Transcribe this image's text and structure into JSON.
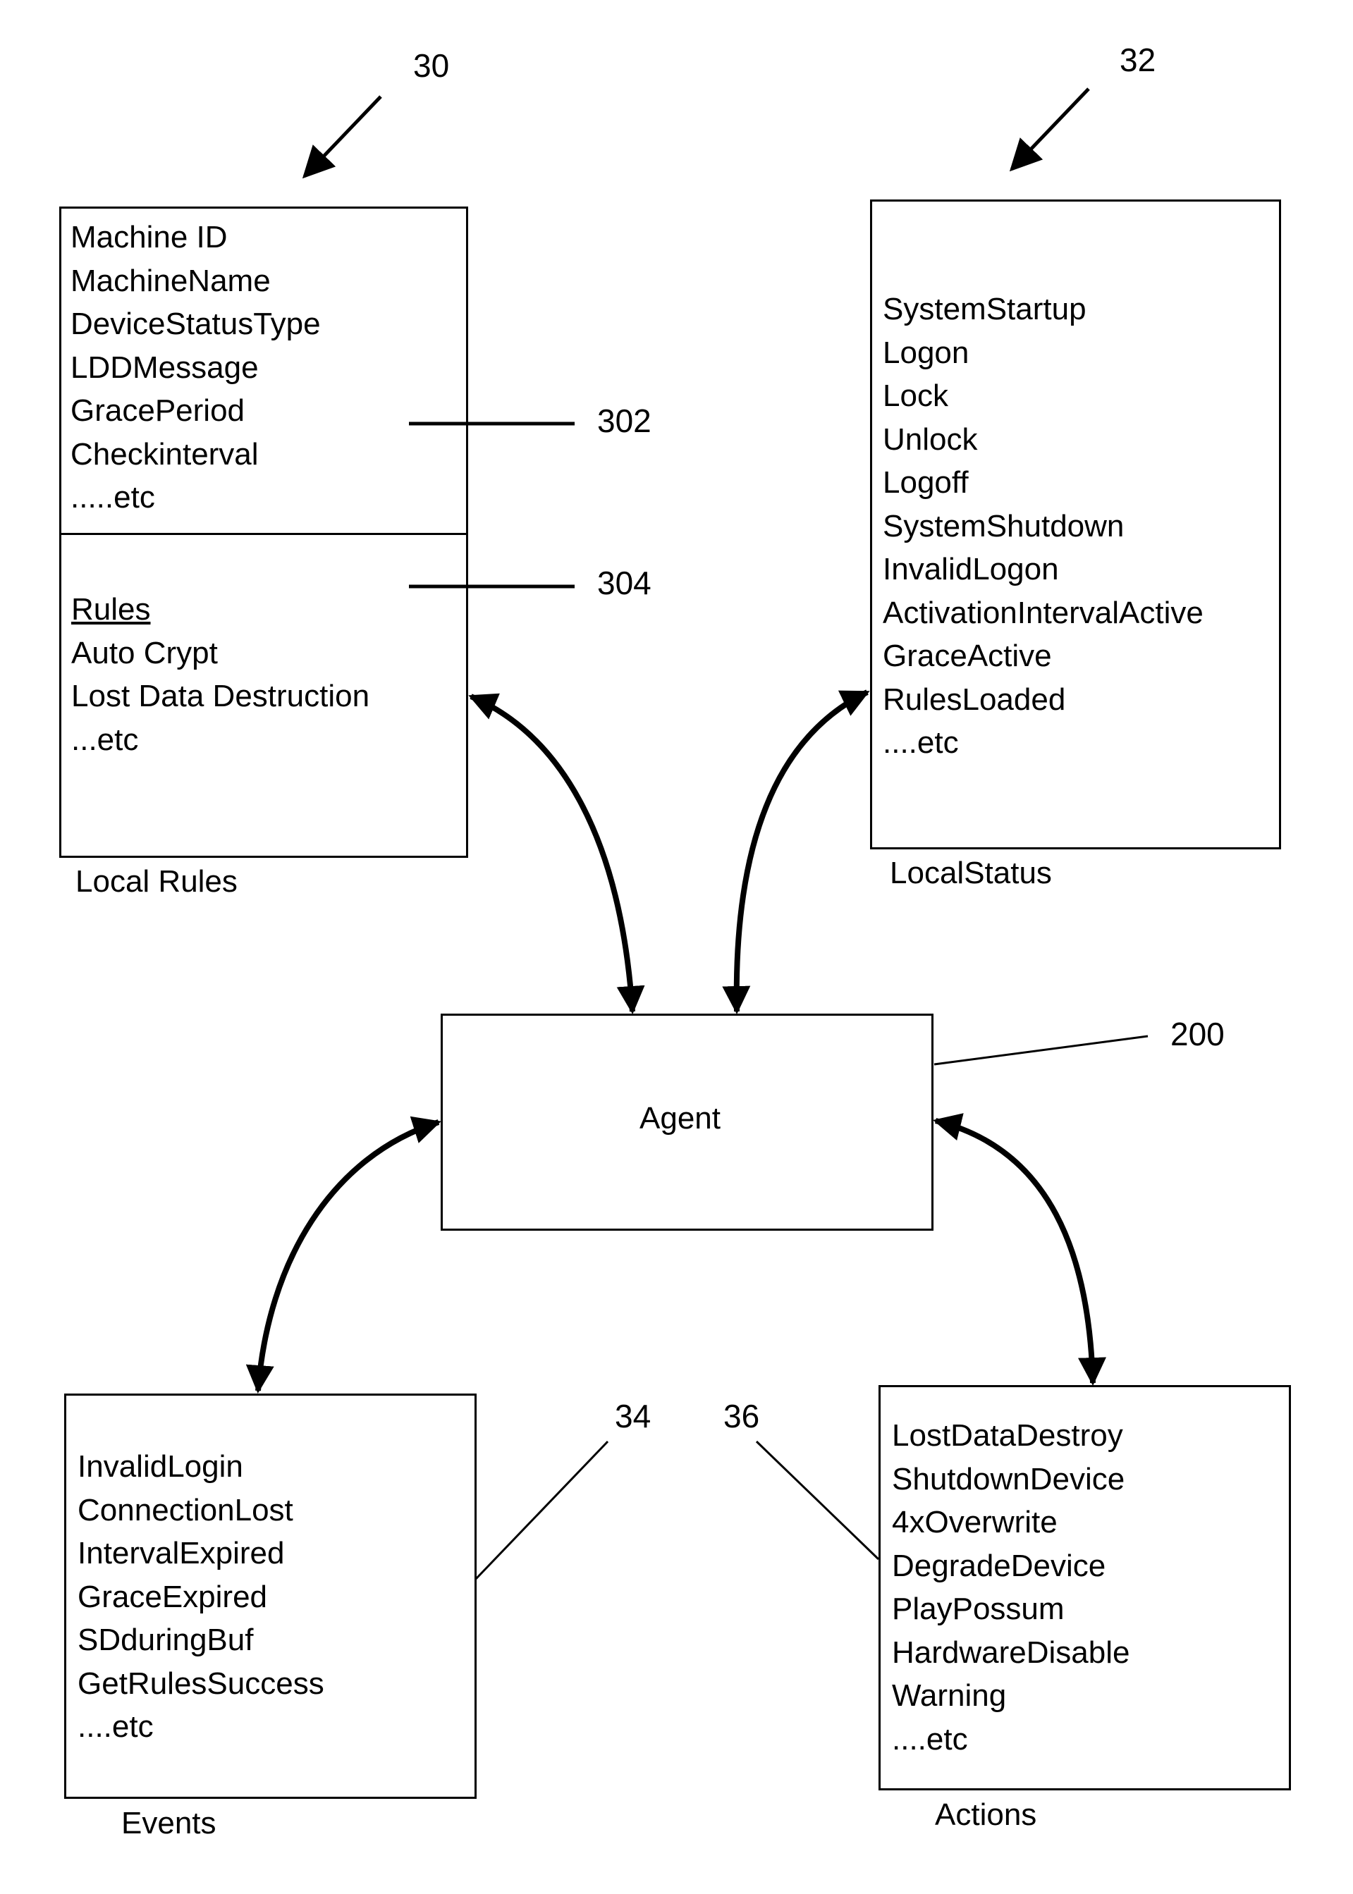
{
  "figure": {
    "local_rules": {
      "ref": "30",
      "caption": "Local Rules",
      "section_302": {
        "ref": "302",
        "items": [
          "Machine ID",
          "MachineName",
          "DeviceStatusType",
          "LDDMessage",
          "GracePeriod",
          "Checkinterval",
          ".....etc"
        ]
      },
      "section_304": {
        "ref": "304",
        "heading": "Rules",
        "items": [
          "Auto Crypt",
          "Lost Data Destruction",
          "...etc"
        ]
      }
    },
    "local_status": {
      "ref": "32",
      "caption": "LocalStatus",
      "items": [
        "SystemStartup",
        "Logon",
        "Lock",
        "Unlock",
        "Logoff",
        "SystemShutdown",
        "InvalidLogon",
        "ActivationIntervalActive",
        "GraceActive",
        "RulesLoaded",
        "....etc"
      ]
    },
    "agent": {
      "ref": "200",
      "label": "Agent"
    },
    "events": {
      "ref": "34",
      "caption": "Events",
      "items": [
        "InvalidLogin",
        "ConnectionLost",
        "IntervalExpired",
        "GraceExpired",
        "SDduringBuf",
        "GetRulesSuccess",
        "....etc"
      ]
    },
    "actions": {
      "ref": "36",
      "caption": "Actions",
      "items": [
        "LostDataDestroy",
        "ShutdownDevice",
        "4xOverwrite",
        "DegradeDevice",
        "PlayPossum",
        "HardwareDisable",
        "Warning",
        "....etc"
      ]
    }
  }
}
